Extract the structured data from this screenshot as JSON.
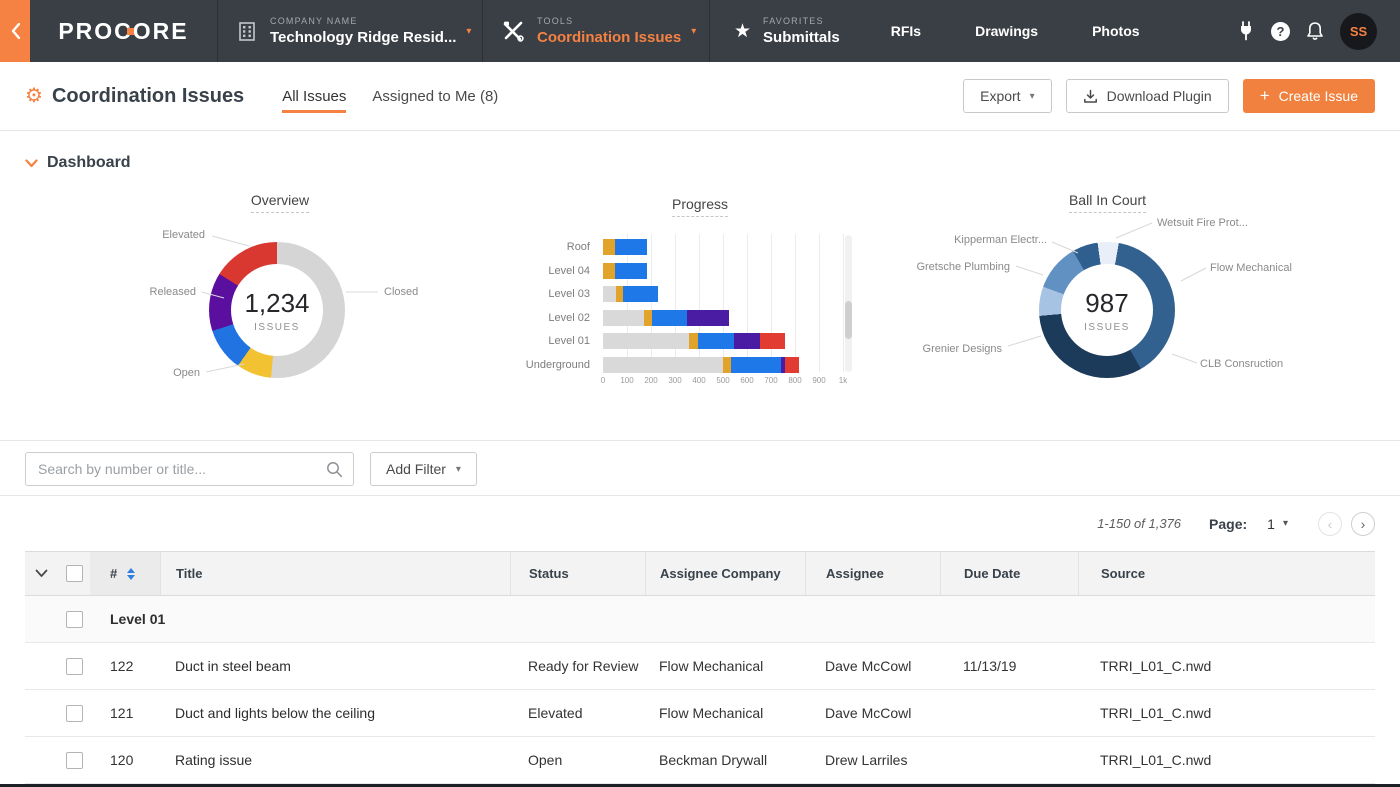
{
  "colors": {
    "accent": "#f58142",
    "nav_bg": "#3a3f45",
    "primary_button": "#f0813f"
  },
  "nav": {
    "logo": "PROCORE",
    "company_label": "COMPANY NAME",
    "company_value": "Technology Ridge Resid...",
    "tools_label": "TOOLS",
    "tools_value": "Coordination Issues",
    "favorites_label": "FAVORITES",
    "favorites_value": "Submittals",
    "links": [
      "RFIs",
      "Drawings",
      "Photos"
    ],
    "avatar_initials": "SS"
  },
  "header": {
    "title": "Coordination Issues",
    "tab_all": "All Issues",
    "tab_assigned": "Assigned to Me (8)",
    "export_label": "Export",
    "download_label": "Download Plugin",
    "create_label": "Create Issue"
  },
  "dashboard": {
    "section_label": "Dashboard"
  },
  "chart_data": [
    {
      "type": "pie",
      "title": "Overview",
      "center_value": "1,234",
      "center_label": "ISSUES",
      "unit": "degrees",
      "start_angle": 0,
      "legend_position": "callout-labels",
      "segments": [
        {
          "label": "Closed",
          "value": 185,
          "color": "#d5d5d5"
        },
        {
          "label": "",
          "value": 30,
          "color": "#f2c233"
        },
        {
          "label": "Open",
          "value": 37,
          "color": "#2273e2"
        },
        {
          "label": "Released",
          "value": 50,
          "color": "#5b0f9e"
        },
        {
          "label": "Elevated",
          "value": 58,
          "color": "#d93831"
        }
      ]
    },
    {
      "type": "bar",
      "title": "Progress",
      "orientation": "horizontal",
      "stacked": true,
      "grid": true,
      "categories": [
        "Roof",
        "Level 04",
        "Level 03",
        "Level 02",
        "Level 01",
        "Underground"
      ],
      "series": [
        {
          "name": "gray",
          "color": "#d9d9d9",
          "values": [
            0,
            0,
            55,
            170,
            360,
            500
          ]
        },
        {
          "name": "yellow",
          "color": "#e2a32a",
          "values": [
            50,
            50,
            30,
            35,
            35,
            35
          ]
        },
        {
          "name": "blue",
          "color": "#1e78e8",
          "values": [
            135,
            135,
            145,
            145,
            150,
            205
          ]
        },
        {
          "name": "purple",
          "color": "#4a1ca3",
          "values": [
            0,
            0,
            0,
            175,
            110,
            20
          ]
        },
        {
          "name": "red",
          "color": "#e23b32",
          "values": [
            0,
            0,
            0,
            0,
            105,
            55
          ]
        }
      ],
      "x_ticks": [
        "0",
        "100",
        "200",
        "300",
        "400",
        "500",
        "600",
        "700",
        "800",
        "900",
        "1k"
      ],
      "xlim": [
        0,
        1000
      ],
      "xlabel": "",
      "ylabel": ""
    },
    {
      "type": "pie",
      "title": "Ball In Court",
      "center_value": "987",
      "center_label": "ISSUES",
      "unit": "degrees",
      "start_angle": -8,
      "legend_position": "callout-labels",
      "segments": [
        {
          "label": "Wetsuit Fire Prot...",
          "value": 18,
          "color": "#e9eff8"
        },
        {
          "label": "Flow Mechanical",
          "value": 140,
          "color": "#32608f"
        },
        {
          "label": "CLB Consruction",
          "value": 115,
          "color": "#1c3a5a"
        },
        {
          "label": "Grenier Designs",
          "value": 25,
          "color": "#a6c3e3"
        },
        {
          "label": "Gretsche Plumbing",
          "value": 40,
          "color": "#6191c2"
        },
        {
          "label": "Kipperman Electr...",
          "value": 22,
          "color": "#2f5f8e"
        }
      ]
    }
  ],
  "filters": {
    "search_placeholder": "Search by number or title...",
    "add_filter_label": "Add Filter"
  },
  "pagination": {
    "range": "1-150 of 1,376",
    "page_label": "Page:",
    "current_page": "1"
  },
  "table": {
    "columns": [
      "#",
      "Title",
      "Status",
      "Assignee Company",
      "Assignee",
      "Due Date",
      "Source"
    ],
    "group_label": "Level 01",
    "rows": [
      {
        "num": "122",
        "title": "Duct in steel beam",
        "status": "Ready for Review",
        "assignee_company": "Flow Mechanical",
        "assignee": "Dave McCowl",
        "due_date": "11/13/19",
        "source": "TRRI_L01_C.nwd"
      },
      {
        "num": "121",
        "title": "Duct and lights below the ceiling",
        "status": "Elevated",
        "assignee_company": "Flow Mechanical",
        "assignee": "Dave McCowl",
        "due_date": "",
        "source": "TRRI_L01_C.nwd"
      },
      {
        "num": "120",
        "title": "Rating issue",
        "status": "Open",
        "assignee_company": "Beckman Drywall",
        "assignee": "Drew Larriles",
        "due_date": "",
        "source": "TRRI_L01_C.nwd"
      }
    ]
  }
}
